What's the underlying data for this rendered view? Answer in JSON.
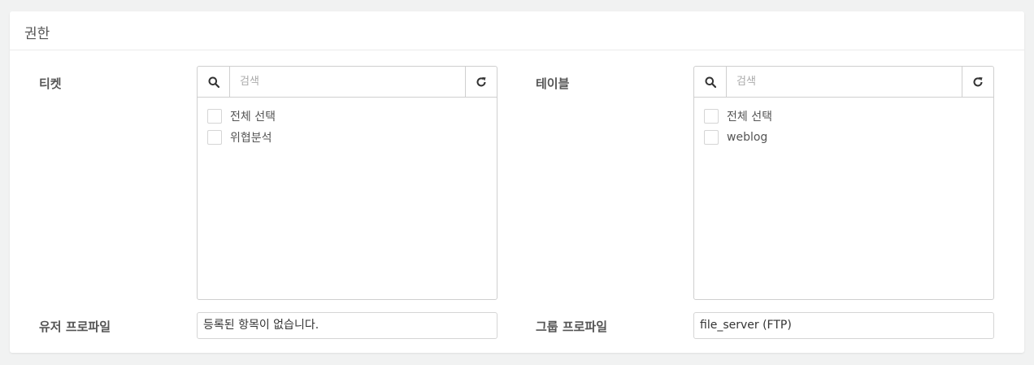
{
  "card": {
    "title": "권한"
  },
  "ticket": {
    "label": "티켓",
    "search_placeholder": "검색",
    "items": [
      "전체 선택",
      "위협분석"
    ]
  },
  "table": {
    "label": "테이블",
    "search_placeholder": "검색",
    "items": [
      "전체 선택",
      "weblog"
    ]
  },
  "user_profile": {
    "label": "유저 프로파일",
    "value": "등록된 항목이 없습니다."
  },
  "group_profile": {
    "label": "그룹 프로파일",
    "value": "file_server (FTP)"
  },
  "icons": {
    "search": "search-icon",
    "refresh": "refresh-icon",
    "checkbox": "checkbox-icon"
  }
}
